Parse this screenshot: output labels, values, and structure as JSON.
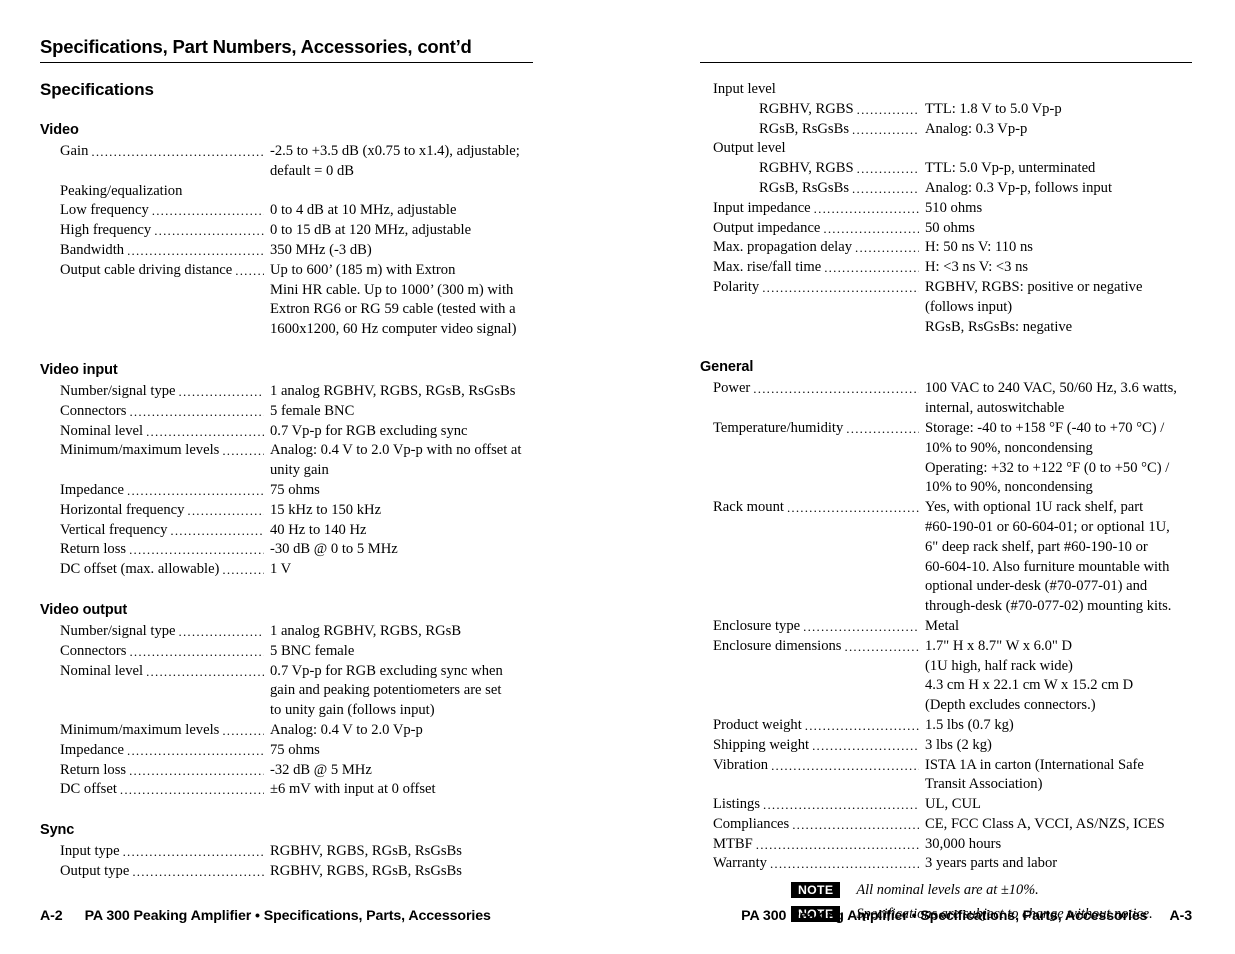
{
  "running_head": "Specifications, Part Numbers, Accessories, cont’d",
  "left_column": {
    "page_heading": "Specifications",
    "groups": [
      {
        "title": "Video",
        "rows": [
          {
            "label": "Gain",
            "value": "-2.5 to +3.5 dB (x0.75 to x1.4), adjustable;\ndefault = 0 dB"
          },
          {
            "label": "Peaking/equalization",
            "bare": true
          },
          {
            "label": "Low frequency",
            "value": "0 to 4 dB at 10 MHz, adjustable"
          },
          {
            "label": "High frequency",
            "value": "0 to 15 dB at 120 MHz, adjustable"
          },
          {
            "label": "Bandwidth",
            "value": "350 MHz (-3 dB)"
          },
          {
            "label": "Output cable driving distance",
            "value": "Up to 600’ (185 m) with Extron\nMini HR cable.  Up to 1000’ (300 m) with\nExtron RG6 or RG 59 cable (tested with a\n1600x1200, 60 Hz computer video signal)"
          }
        ]
      },
      {
        "title": "Video input",
        "rows": [
          {
            "label": "Number/signal type",
            "value": "1 analog RGBHV, RGBS, RGsB, RsGsBs"
          },
          {
            "label": "Connectors",
            "value": "5 female BNC"
          },
          {
            "label": "Nominal level",
            "value": "0.7 Vp-p for RGB excluding sync"
          },
          {
            "label": "Minimum/maximum levels",
            "value": "Analog: 0.4 V to 2.0 Vp-p with no offset at\nunity gain"
          },
          {
            "label": "Impedance",
            "value": "75 ohms"
          },
          {
            "label": "Horizontal frequency",
            "value": "15 kHz to 150 kHz"
          },
          {
            "label": "Vertical frequency",
            "value": "40 Hz to 140 Hz"
          },
          {
            "label": "Return loss",
            "value": "-30 dB @ 0 to 5 MHz"
          },
          {
            "label": "DC offset (max. allowable)",
            "value": "1 V"
          }
        ]
      },
      {
        "title": "Video output",
        "rows": [
          {
            "label": "Number/signal type",
            "value": "1 analog RGBHV, RGBS, RGsB"
          },
          {
            "label": "Connectors",
            "value": "5 BNC female"
          },
          {
            "label": "Nominal level",
            "value": "0.7 Vp-p for RGB excluding sync when\ngain and peaking potentiometers are set\nto unity gain (follows input)"
          },
          {
            "label": "Minimum/maximum levels",
            "value": "Analog: 0.4 V to 2.0 Vp-p"
          },
          {
            "label": "Impedance",
            "value": "75 ohms"
          },
          {
            "label": "Return loss",
            "value": "-32 dB @ 5 MHz"
          },
          {
            "label": "DC offset",
            "value": "±6 mV with input at 0 offset"
          }
        ]
      },
      {
        "title": "Sync",
        "rows": [
          {
            "label": "Input type",
            "value": "RGBHV, RGBS, RGsB, RsGsBs"
          },
          {
            "label": "Output type",
            "value": "RGBHV, RGBS, RGsB, RsGsBs"
          }
        ]
      }
    ]
  },
  "right_column": {
    "top_rows": [
      {
        "label": "Input level",
        "bare": true
      },
      {
        "label": "RGBHV, RGBS",
        "value": "TTL: 1.8 V to 5.0 Vp-p",
        "sub": true
      },
      {
        "label": "RGsB, RsGsBs",
        "value": "Analog: 0.3 Vp-p",
        "sub": true
      },
      {
        "label": "Output level",
        "bare": true
      },
      {
        "label": "RGBHV, RGBS",
        "value": "TTL: 5.0 Vp-p, unterminated",
        "sub": true
      },
      {
        "label": "RGsB, RsGsBs",
        "value": "Analog: 0.3 Vp-p, follows input",
        "sub": true
      },
      {
        "label": "Input impedance",
        "value": "510 ohms"
      },
      {
        "label": "Output impedance",
        "value": "50 ohms"
      },
      {
        "label": "Max. propagation delay",
        "value": "H: 50 ns V: 110 ns"
      },
      {
        "label": "Max. rise/fall time",
        "value": "H: <3 ns V: <3 ns"
      },
      {
        "label": "Polarity",
        "value": "RGBHV, RGBS: positive or negative\n(follows input)\nRGsB, RsGsBs: negative"
      }
    ],
    "general": {
      "title": "General",
      "rows": [
        {
          "label": "Power",
          "value": "100 VAC to 240 VAC, 50/60 Hz, 3.6 watts,\ninternal, autoswitchable"
        },
        {
          "label": "Temperature/humidity",
          "value": "Storage: -40 to +158 °F (-40 to +70 °C) /\n10% to 90%, noncondensing\nOperating: +32 to +122 °F (0 to +50 °C) /\n10% to 90%, noncondensing"
        },
        {
          "label": "Rack mount",
          "value": "Yes, with optional 1U rack shelf, part\n#60-190-01 or 60-604-01; or optional 1U,\n6\" deep rack shelf, part #60-190-10 or\n60-604-10.  Also furniture mountable with\noptional under-desk (#70-077-01) and\nthrough-desk (#70-077-02) mounting kits."
        },
        {
          "label": "Enclosure type",
          "value": "Metal"
        },
        {
          "label": "Enclosure dimensions",
          "value": "1.7\" H x 8.7\" W x 6.0\" D\n(1U high, half rack wide)\n4.3 cm H x 22.1 cm W x 15.2 cm D\n(Depth excludes connectors.)"
        },
        {
          "label": "Product weight",
          "value": "1.5 lbs (0.7 kg)"
        },
        {
          "label": "Shipping weight",
          "value": "3 lbs  (2 kg)"
        },
        {
          "label": "Vibration",
          "value": "ISTA 1A in carton (International Safe\nTransit Association)"
        },
        {
          "label": "Listings",
          "value": "UL, CUL"
        },
        {
          "label": "Compliances",
          "value": "CE, FCC Class A, VCCI, AS/NZS, ICES"
        },
        {
          "label": "MTBF",
          "value": "30,000 hours"
        },
        {
          "label": "Warranty",
          "value": "3 years parts and labor"
        }
      ]
    },
    "notes": [
      {
        "badge": "NOTE",
        "text": "All nominal levels are at ±10%."
      },
      {
        "badge": "NOTE",
        "text": "Specifications are subject to change without notice."
      }
    ]
  },
  "footer": {
    "left_folio": "A-2",
    "left_title": "PA 300 Peaking Amplifier • Specifications, Parts, Accessories",
    "right_title": "PA 300 Peaking Amplifier • Specifications, Parts, Accessories",
    "right_folio": "A-3"
  }
}
